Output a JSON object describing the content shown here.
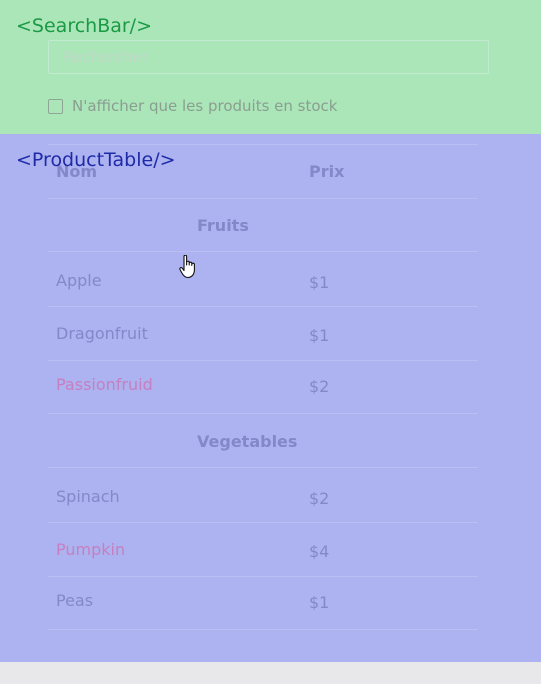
{
  "searchbar": {
    "tag": "<SearchBar/>",
    "placeholder": "Rechercher",
    "stock_label": "N'afficher que les produits en stock"
  },
  "producttable": {
    "tag": "<ProductTable/>",
    "headers": {
      "name": "Nom",
      "price": "Prix"
    },
    "categories": [
      {
        "name": "Fruits",
        "rows": [
          {
            "name": "Apple",
            "price": "$1",
            "in_stock": true
          },
          {
            "name": "Dragonfruit",
            "price": "$1",
            "in_stock": true
          },
          {
            "name": "Passionfruid",
            "price": "$2",
            "in_stock": false
          }
        ]
      },
      {
        "name": "Vegetables",
        "rows": [
          {
            "name": "Spinach",
            "price": "$2",
            "in_stock": true
          },
          {
            "name": "Pumpkin",
            "price": "$4",
            "in_stock": false
          },
          {
            "name": "Peas",
            "price": "$1",
            "in_stock": true
          }
        ]
      }
    ]
  },
  "colors": {
    "searchbar_overlay": "#abe6b9",
    "producttable_overlay": "#acb3f0",
    "searchbar_tag": "#1a9a45",
    "producttable_tag": "#1f2aa6",
    "out_of_stock": "#c67fc0"
  },
  "icons": {
    "cursor": "hand-pointer-icon"
  }
}
